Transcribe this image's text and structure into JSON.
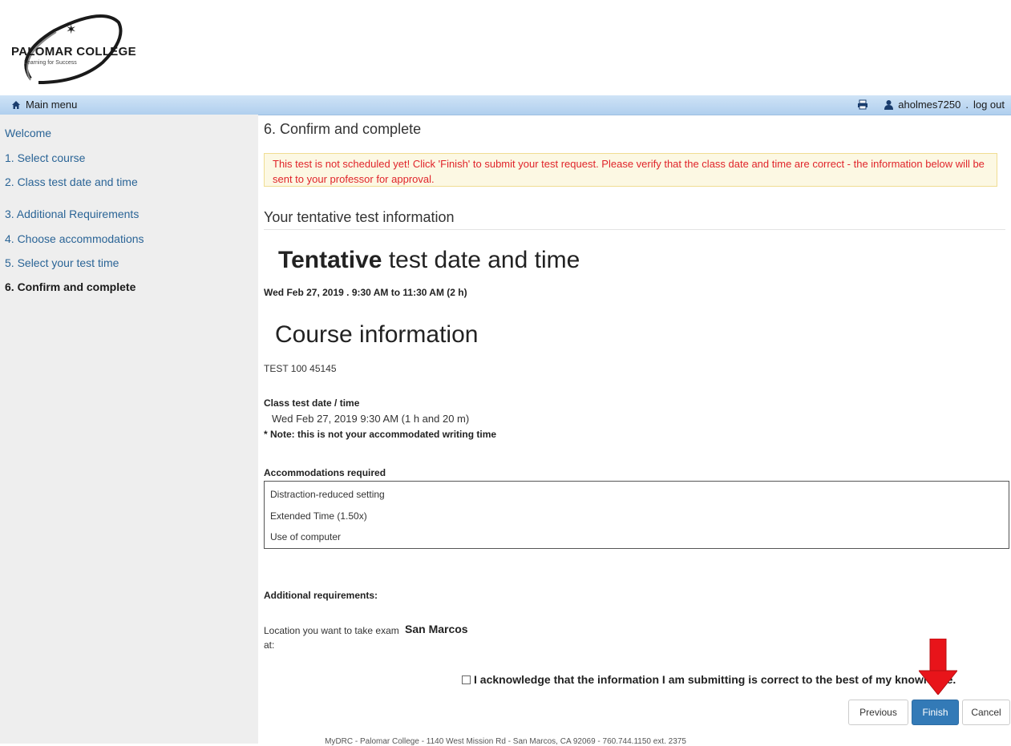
{
  "header": {
    "logo_name": "PALOMAR COLLEGE",
    "logo_tagline": "Learning for Success"
  },
  "navbar": {
    "main_menu_label": "Main menu",
    "username": "aholmes7250",
    "separator": ".",
    "logout_label": "log out"
  },
  "sidebar": {
    "items": [
      {
        "label": "Welcome"
      },
      {
        "label": "1. Select course"
      },
      {
        "label": "2. Class test date and time"
      },
      {
        "label": "3. Additional Requirements"
      },
      {
        "label": "4. Choose accommodations"
      },
      {
        "label": "5. Select your test time"
      },
      {
        "label": "6. Confirm and complete"
      }
    ]
  },
  "main": {
    "step_title": "6. Confirm and complete",
    "alert_text": "This test is not scheduled yet! Click 'Finish' to submit your test request. Please verify that the class date and time are correct - the information below will be sent to your professor for approval.",
    "section_title": "Your tentative test information",
    "tentative_bold": "Tentative",
    "tentative_rest": " test date and time",
    "tentative_datetime": "Wed Feb 27, 2019 . 9:30 AM to 11:30 AM (2 h)",
    "course_heading": "Course information",
    "course_code": "TEST 100 45145",
    "class_test_label": "Class test date / time",
    "class_test_value": "Wed Feb 27, 2019 9:30 AM (1 h and 20 m)",
    "class_test_note": "* Note: this is not your accommodated writing time",
    "accommodations_label": "Accommodations required",
    "accommodations": [
      "Distraction-reduced setting",
      "Extended Time (1.50x)",
      "Use of computer"
    ],
    "additional_label": "Additional requirements:",
    "location_label": "Location you want to take exam at:",
    "location_value": "San Marcos",
    "acknowledge_text": "I acknowledge that the information I am submitting is correct to the best of my knowledge.",
    "buttons": {
      "previous": "Previous",
      "finish": "Finish",
      "cancel": "Cancel"
    }
  },
  "footer": {
    "text": "MyDRC - Palomar College - 1140 West Mission Rd - San Marcos, CA 92069 - 760.744.1150 ext. 2375"
  },
  "colors": {
    "finish_button": "#337ab7",
    "alert_text": "#e0242a",
    "link": "#2a6496",
    "arrow": "#e8141a"
  }
}
